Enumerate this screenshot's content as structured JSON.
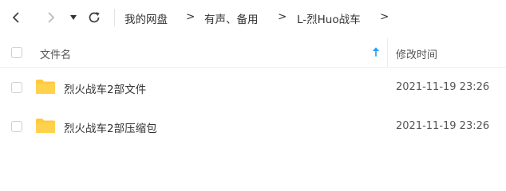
{
  "breadcrumb": {
    "items": [
      "我的网盘",
      "有声、备用",
      "L-烈Huo战车"
    ],
    "separator": ">"
  },
  "table": {
    "header": {
      "name": "文件名",
      "modified": "修改时间"
    },
    "rows": [
      {
        "name": "烈火战车2部文件",
        "modified": "2021-11-19 23:26"
      },
      {
        "name": "烈火战车2部压缩包",
        "modified": "2021-11-19 23:26"
      }
    ]
  },
  "colors": {
    "folder": "#FFC93C",
    "sort_arrow": "#1E9FFF"
  }
}
